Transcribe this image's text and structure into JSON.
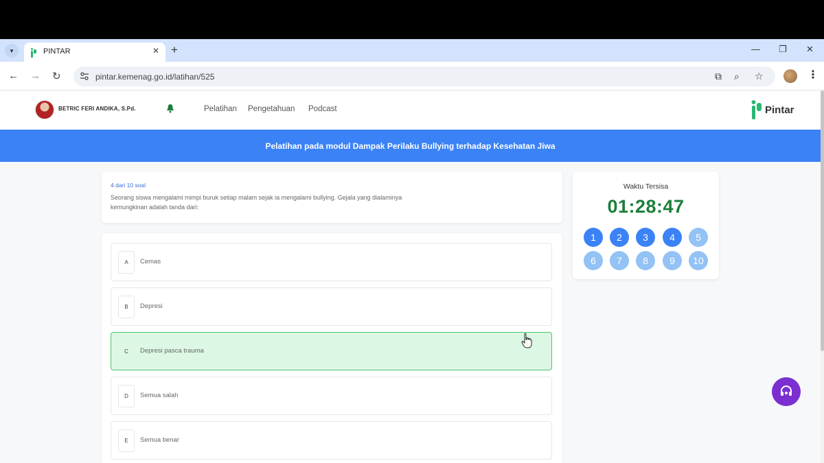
{
  "browser": {
    "tab_title": "PINTAR",
    "url": "pintar.kemenag.go.id/latihan/525"
  },
  "header": {
    "user_name": "BETRIC FERI ANDIKA, S.Pd.",
    "menu": [
      "Pelatihan",
      "Pengetahuan",
      "Podcast"
    ],
    "logo_text": "Pintar"
  },
  "banner": {
    "title": "Pelatihan pada modul Dampak Perilaku Bullying terhadap Kesehatan Jiwa"
  },
  "question": {
    "counter": "4 dari 10 soal",
    "text": "Seorang siswa mengalami mimpi buruk setiap malam sejak ia mengalami bullying. Gejala yang dialaminya kemungkinan adalah tanda dari:"
  },
  "options": [
    {
      "letter": "A",
      "text": "Cemas",
      "selected": false
    },
    {
      "letter": "B",
      "text": "Depresi",
      "selected": false
    },
    {
      "letter": "C",
      "text": "Depresi pasca trauma",
      "selected": true
    },
    {
      "letter": "D",
      "text": "Semua salah",
      "selected": false
    },
    {
      "letter": "E",
      "text": "Semua benar",
      "selected": false
    }
  ],
  "timer": {
    "label": "Waktu Tersisa",
    "value": "01:28:47"
  },
  "question_nav": [
    {
      "label": "1",
      "status": "done"
    },
    {
      "label": "2",
      "status": "done"
    },
    {
      "label": "3",
      "status": "done"
    },
    {
      "label": "4",
      "status": "done"
    },
    {
      "label": "5",
      "status": "todo"
    },
    {
      "label": "6",
      "status": "todo"
    },
    {
      "label": "7",
      "status": "todo"
    },
    {
      "label": "8",
      "status": "todo"
    },
    {
      "label": "9",
      "status": "todo"
    },
    {
      "label": "10",
      "status": "todo"
    }
  ],
  "colors": {
    "primary": "#3b82f6",
    "done": "#3b82f6",
    "todo": "#93c2f4",
    "selected_bg": "#dcf7e3",
    "selected_border": "#4cc46a",
    "timer": "#1b7f3a",
    "support": "#7b2fd1"
  },
  "icons": {
    "notification": "bell-icon",
    "support": "headset-icon"
  }
}
